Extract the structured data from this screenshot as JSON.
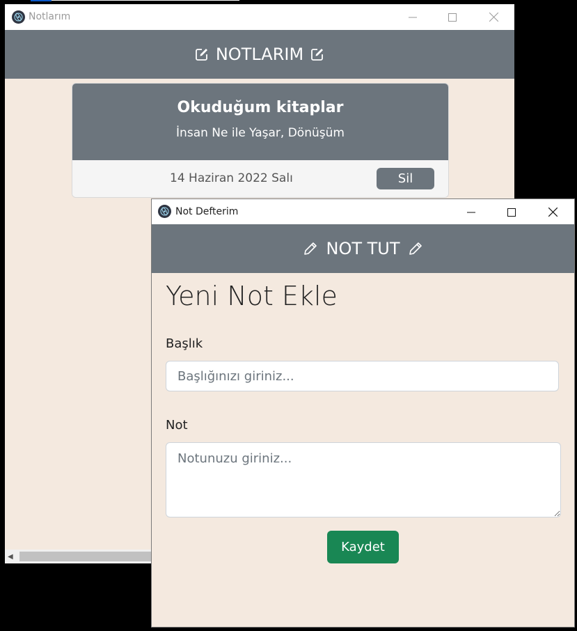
{
  "window1": {
    "title": "Notlarım",
    "header": "NOTLARIM",
    "note": {
      "title": "Okuduğum kitaplar",
      "text": "İnsan Ne ile Yaşar, Dönüşüm",
      "date": "14 Haziran 2022 Salı",
      "delete_label": "Sil"
    }
  },
  "window2": {
    "title": "Not Defterim",
    "header": "NOT TUT",
    "form_title": "Yeni Not Ekle",
    "title_label": "Başlık",
    "title_placeholder": "Başlığınızı giriniz...",
    "note_label": "Not",
    "note_placeholder": "Notunuzu giriniz...",
    "save_label": "Kaydet"
  },
  "colors": {
    "header_bg": "#6c757d",
    "page_bg": "#f4e9df",
    "save_button": "#198754"
  },
  "icons": [
    "app-icon",
    "edit-square-icon",
    "pencil-icon",
    "minimize-icon",
    "maximize-icon",
    "close-icon"
  ]
}
